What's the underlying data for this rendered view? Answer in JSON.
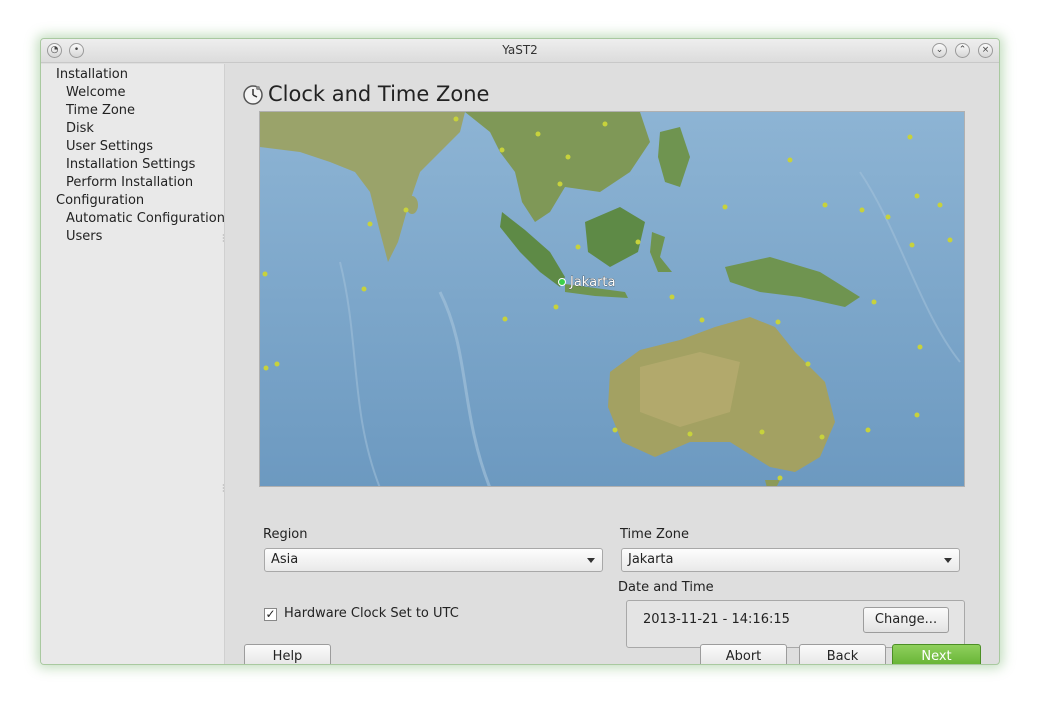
{
  "window": {
    "title": "YaST2"
  },
  "sidebar": {
    "sections": [
      {
        "label": "Installation"
      },
      {
        "label": "Welcome"
      },
      {
        "label": "Time Zone"
      },
      {
        "label": "Disk"
      },
      {
        "label": "User Settings"
      },
      {
        "label": "Installation Settings"
      },
      {
        "label": "Perform Installation"
      },
      {
        "label": "Configuration"
      },
      {
        "label": "Automatic Configuration"
      },
      {
        "label": "Users"
      }
    ]
  },
  "main": {
    "title": "Clock and Time Zone",
    "map": {
      "selected_city": "Jakarta"
    },
    "region": {
      "label": "Region",
      "value": "Asia"
    },
    "timezone": {
      "label": "Time Zone",
      "value": "Jakarta"
    },
    "hw_clock": {
      "label": "Hardware Clock Set to UTC",
      "checked": true
    },
    "datetime": {
      "label": "Date and Time",
      "value": "2013-11-21 - 14:16:15",
      "change_label": "Change..."
    }
  },
  "buttons": {
    "help": "Help",
    "abort": "Abort",
    "back": "Back",
    "next": "Next"
  },
  "colors": {
    "accent_green": "#6cba3a",
    "window_border": "#a9c9a0"
  }
}
